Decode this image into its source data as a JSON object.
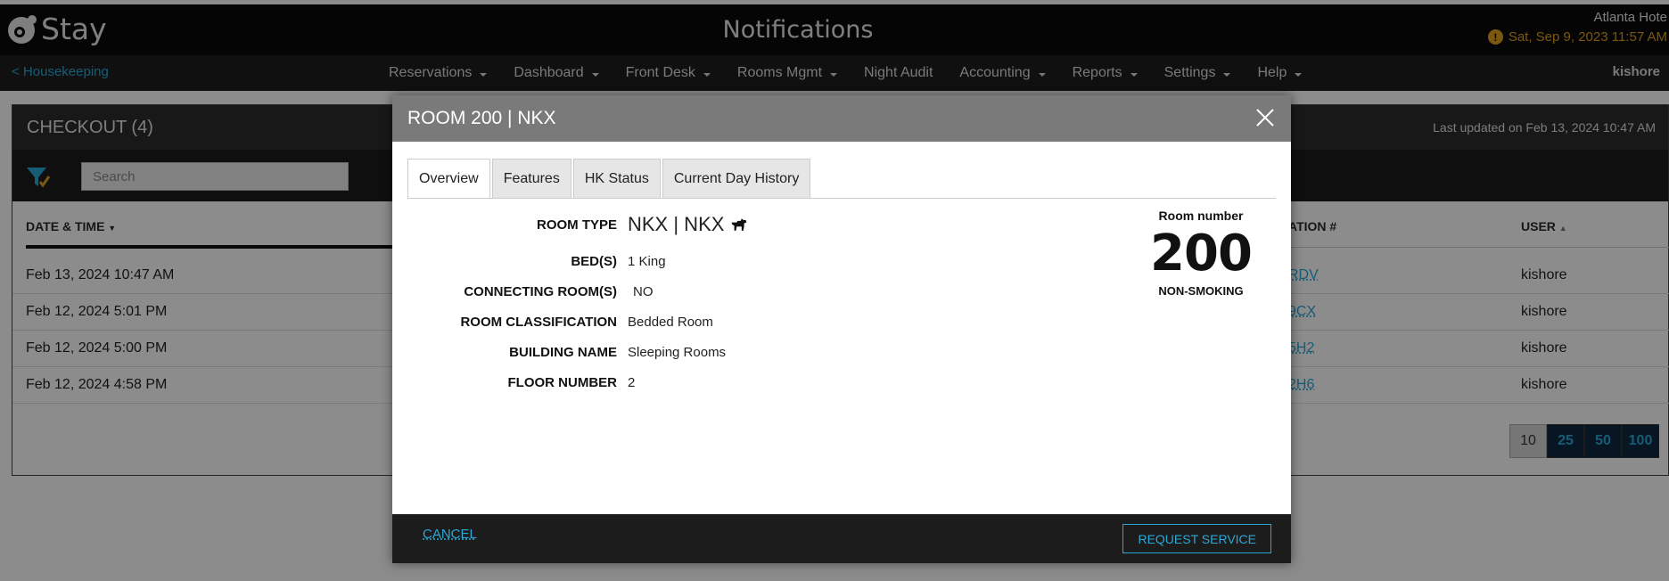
{
  "app": {
    "logo_text": "Stay",
    "page_title": "Notifications",
    "hotel_name": "Atlanta Hote",
    "datetime": "Sat, Sep 9, 2023 11:57 AM",
    "user": "kishore"
  },
  "nav": {
    "back_label": "< Housekeeping",
    "items": [
      {
        "label": "Reservations",
        "dropdown": true
      },
      {
        "label": "Dashboard",
        "dropdown": true
      },
      {
        "label": "Front Desk",
        "dropdown": true
      },
      {
        "label": "Rooms Mgmt",
        "dropdown": true
      },
      {
        "label": "Night Audit",
        "dropdown": false
      },
      {
        "label": "Accounting",
        "dropdown": true
      },
      {
        "label": "Reports",
        "dropdown": true
      },
      {
        "label": "Settings",
        "dropdown": true
      },
      {
        "label": "Help",
        "dropdown": true
      }
    ]
  },
  "panel": {
    "title": "CHECKOUT (4)",
    "last_updated": "Last updated on Feb 13, 2024 10:47 AM",
    "search_placeholder": "Search",
    "columns": {
      "date_time": "DATE & TIME",
      "confirmation": "ATION #",
      "user": "USER"
    },
    "rows": [
      {
        "date_time": "Feb 13, 2024 10:47 AM",
        "confirmation": "RDV",
        "user": "kishore"
      },
      {
        "date_time": "Feb 12, 2024 5:01 PM",
        "confirmation": "9CX",
        "user": "kishore"
      },
      {
        "date_time": "Feb 12, 2024 5:00 PM",
        "confirmation": "5H2",
        "user": "kishore"
      },
      {
        "date_time": "Feb 12, 2024 4:58 PM",
        "confirmation": "2H6",
        "user": "kishore"
      }
    ],
    "page_sizes": [
      "10",
      "25",
      "50",
      "100"
    ],
    "active_page_size": "10"
  },
  "modal": {
    "title": "ROOM 200 | NKX",
    "tabs": [
      "Overview",
      "Features",
      "HK Status",
      "Current Day History"
    ],
    "active_tab": "Overview",
    "fields": [
      {
        "label": "ROOM TYPE",
        "value": "NKX | NKX"
      },
      {
        "label": "BED(S)",
        "value": "1 King"
      },
      {
        "label": "CONNECTING ROOM(S)",
        "value": "NO"
      },
      {
        "label": "ROOM CLASSIFICATION",
        "value": "Bedded Room"
      },
      {
        "label": "BUILDING NAME",
        "value": "Sleeping Rooms"
      },
      {
        "label": "FLOOR NUMBER",
        "value": "2"
      }
    ],
    "room_number_label": "Room number",
    "room_number": "200",
    "smoking": "NON-SMOKING",
    "cancel_label": "CANCEL",
    "request_label": "REQUEST SERVICE"
  },
  "colors": {
    "accent": "#2aa8d8",
    "warning": "#e0a020",
    "header_bg": "#0a0a0a"
  }
}
